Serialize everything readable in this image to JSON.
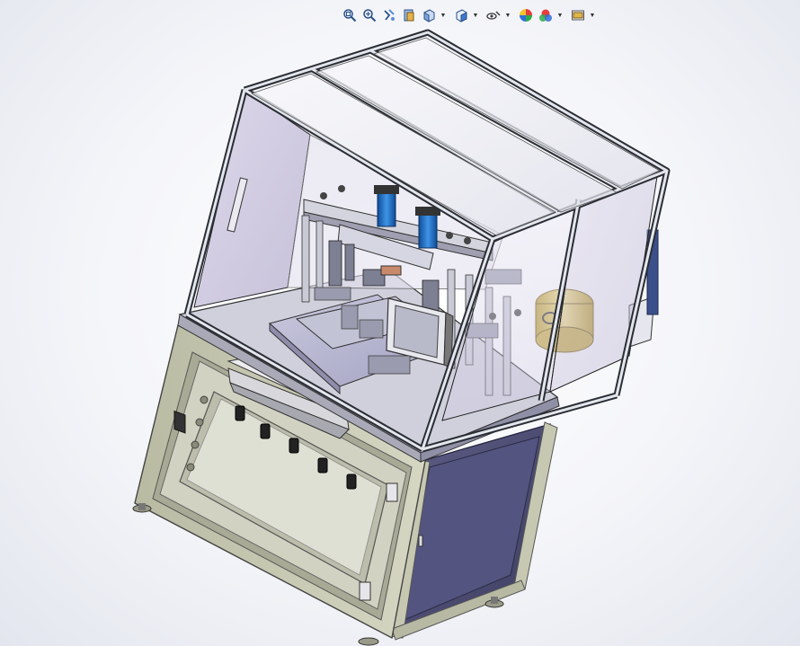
{
  "toolbar": {
    "items": [
      {
        "name": "zoom-to-fit-icon",
        "dropdown": false
      },
      {
        "name": "zoom-to-area-icon",
        "dropdown": false
      },
      {
        "name": "previous-view-icon",
        "dropdown": false
      },
      {
        "name": "section-view-icon",
        "dropdown": false
      },
      {
        "name": "view-orientation-icon",
        "dropdown": true
      },
      {
        "name": "display-style-icon",
        "dropdown": true
      },
      {
        "name": "hide-show-items-icon",
        "dropdown": true
      },
      {
        "name": "edit-appearance-icon",
        "dropdown": false
      },
      {
        "name": "apply-scene-icon",
        "dropdown": true
      },
      {
        "name": "view-settings-icon",
        "dropdown": true
      }
    ]
  },
  "model": {
    "description_visible": false,
    "colors": {
      "frame_base": "#c8c9b4",
      "frame_dark": "#8a8c7a",
      "cabinet_purple": "#4c4c72",
      "cabinet_light": "#6c6c94",
      "glass": "#d6d2e6",
      "profile": "#d9dce2",
      "profile_dark": "#2c2f36",
      "table_top": "#b9b8d2",
      "cylinder_blue": "#1f6fc4",
      "motor_yellow": "#d7c060"
    }
  }
}
